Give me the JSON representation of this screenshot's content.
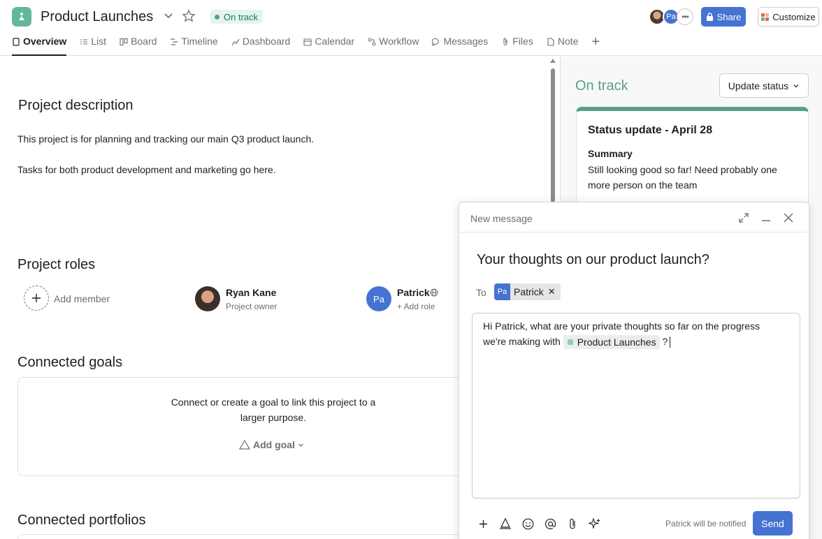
{
  "header": {
    "title": "Product Launches",
    "status": "On track",
    "avatar_initials": "Pa",
    "share_label": "Share",
    "customize_label": "Customize"
  },
  "tabs": [
    {
      "label": "Overview",
      "icon": "document-icon",
      "active": true
    },
    {
      "label": "List",
      "icon": "list-icon"
    },
    {
      "label": "Board",
      "icon": "board-icon"
    },
    {
      "label": "Timeline",
      "icon": "timeline-icon"
    },
    {
      "label": "Dashboard",
      "icon": "dashboard-icon"
    },
    {
      "label": "Calendar",
      "icon": "calendar-icon"
    },
    {
      "label": "Workflow",
      "icon": "workflow-icon"
    },
    {
      "label": "Messages",
      "icon": "message-icon"
    },
    {
      "label": "Files",
      "icon": "paperclip-icon"
    },
    {
      "label": "Note",
      "icon": "note-icon"
    }
  ],
  "description": {
    "heading": "Project description",
    "line1": "This project is for planning and tracking our main Q3 product launch.",
    "line2": "Tasks for both product development and marketing go here."
  },
  "roles": {
    "heading": "Project roles",
    "add_member": "Add member",
    "people": [
      {
        "name": "Ryan Kane",
        "role": "Project owner"
      },
      {
        "name": "Patrick",
        "initials": "Pa",
        "role": "+ Add role"
      }
    ]
  },
  "goals": {
    "heading": "Connected goals",
    "text": "Connect or create a goal to link this project to a larger purpose.",
    "add_goal": "Add goal"
  },
  "portfolios": {
    "heading": "Connected portfolios"
  },
  "status_panel": {
    "status": "On track",
    "update_button": "Update status",
    "card_title": "Status update - April 28",
    "summary_label": "Summary",
    "summary_text": "Still looking good so far! Need probably one more person on the team"
  },
  "composer": {
    "title": "New message",
    "subject": "Your thoughts on our product launch?",
    "to_label": "To",
    "recipient": {
      "initials": "Pa",
      "name": "Patrick"
    },
    "body_before": "Hi Patrick, what are your private thoughts so far on the progress we're making with",
    "mention": "Product Launches",
    "body_after": "?",
    "notified": "Patrick will be notified",
    "send_label": "Send"
  },
  "colors": {
    "accent_blue": "#4573d2",
    "status_green": "#58a182",
    "app_icon": "#62b99a"
  }
}
